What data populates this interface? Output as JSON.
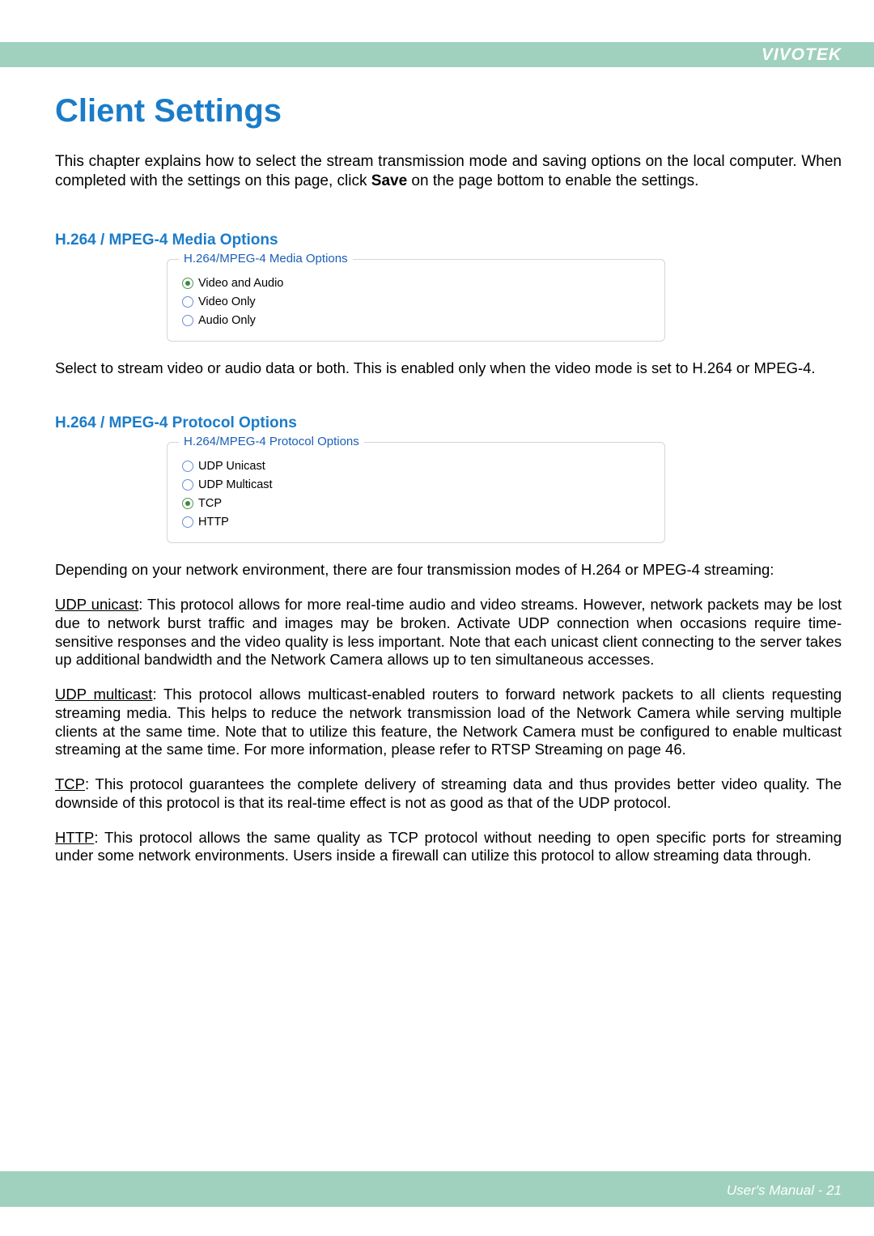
{
  "brand": "VIVOTEK",
  "page_title": "Client Settings",
  "intro_pre": "This chapter explains how to select the stream transmission mode and saving options on the local computer. When completed with the settings on this page, click ",
  "intro_bold": "Save",
  "intro_post": " on the page bottom to enable the settings.",
  "media_section": {
    "heading": "H.264 / MPEG-4 Media Options",
    "legend": "H.264/MPEG-4 Media Options",
    "options": [
      {
        "label": "Video and Audio",
        "selected": true
      },
      {
        "label": "Video Only",
        "selected": false
      },
      {
        "label": "Audio Only",
        "selected": false
      }
    ],
    "caption": "Select to stream video or audio data or both. This is enabled only when the video mode is set to H.264 or MPEG-4."
  },
  "protocol_section": {
    "heading": "H.264 / MPEG-4 Protocol Options",
    "legend": "H.264/MPEG-4 Protocol Options",
    "options": [
      {
        "label": "UDP Unicast",
        "selected": false
      },
      {
        "label": "UDP Multicast",
        "selected": false
      },
      {
        "label": "TCP",
        "selected": true
      },
      {
        "label": "HTTP",
        "selected": false
      }
    ],
    "caption": "Depending on your network environment, there are four transmission modes of H.264 or MPEG-4 streaming:"
  },
  "udp_unicast": {
    "term": "UDP unicast",
    "text": ": This protocol allows for more real-time audio and video streams. However, network packets may be lost due to network burst traffic and images may be broken. Activate UDP connection when occasions require time-sensitive responses and the video quality is less important. Note that each unicast client connecting to the server takes up additional bandwidth and the Network Camera allows up to ten simultaneous accesses."
  },
  "udp_multicast": {
    "term": "UDP multicast",
    "text": ": This protocol allows multicast-enabled routers to forward network packets to all clients requesting streaming media. This helps to reduce the network transmission load of the Network Camera while serving multiple clients at the same time. Note that to utilize this feature, the Network Camera must be configured to enable multicast streaming at the same time. For more information, please refer to RTSP Streaming on page 46."
  },
  "tcp": {
    "term": "TCP",
    "text": ": This protocol guarantees the complete delivery of streaming data and thus provides better video quality. The downside of this protocol is that its real-time effect is not as good as that of the UDP protocol."
  },
  "http": {
    "term": "HTTP",
    "text": ": This protocol allows the same quality as TCP protocol without needing to open specific ports for streaming under some network environments. Users inside a firewall can utilize this protocol to allow streaming data through."
  },
  "footer": "User's Manual - 21"
}
